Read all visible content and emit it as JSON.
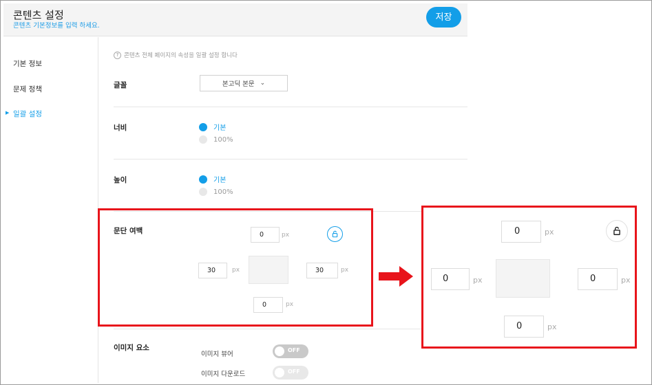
{
  "header": {
    "title": "콘텐츠 설정",
    "subtitle": "콘텐츠 기본정보를 입력 하세요.",
    "save_label": "저장"
  },
  "sidebar": {
    "items": [
      {
        "label": "기본 정보"
      },
      {
        "label": "문제 정책"
      },
      {
        "label": "일괄 설정",
        "active": true
      }
    ]
  },
  "main": {
    "hint": "콘텐츠 전체 페이지의 속성을 일괄 설정 합니다",
    "font": {
      "label": "글꼴",
      "value": "본고딕 본문"
    },
    "width": {
      "label": "너비",
      "options": [
        {
          "label": "기본",
          "selected": true
        },
        {
          "label": "100%",
          "selected": false
        }
      ]
    },
    "height": {
      "label": "높이",
      "options": [
        {
          "label": "기본",
          "selected": true
        },
        {
          "label": "100%",
          "selected": false
        }
      ]
    },
    "margin": {
      "label": "문단 여백",
      "top": "0",
      "left": "30",
      "right": "30",
      "bottom": "0",
      "unit": "px",
      "lock_icon": "unlock-icon"
    },
    "image": {
      "label": "이미지 요소",
      "toggles": [
        {
          "label": "이미지 뷰어",
          "value": "OFF"
        },
        {
          "label": "이미지 다운로드",
          "value": "OFF"
        }
      ]
    }
  },
  "zoom": {
    "top": "0",
    "left": "0",
    "right": "0",
    "bottom": "0",
    "unit": "px",
    "lock_icon": "unlock-icon"
  },
  "colors": {
    "accent": "#139ee8",
    "highlight": "#e8141b"
  }
}
